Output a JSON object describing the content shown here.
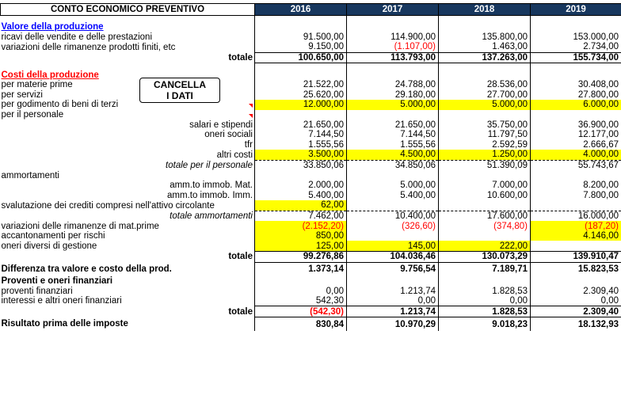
{
  "header": {
    "title": "CONTO ECONOMICO PREVENTIVO",
    "years": [
      "2016",
      "2017",
      "2018",
      "2019"
    ]
  },
  "button": {
    "label": "CANCELLA\nI DATI"
  },
  "rows": [
    {
      "type": "blank"
    },
    {
      "type": "section",
      "label": "Valore della produzione",
      "style": "blue"
    },
    {
      "label": "ricavi delle vendite e delle prestazioni",
      "values": [
        "91.500,00",
        "114.900,00",
        "135.800,00",
        "153.000,00"
      ]
    },
    {
      "label": "variazioni delle rimanenze prodotti finiti, etc",
      "values": [
        "9.150,00",
        "(1.107,00)",
        "1.463,00",
        "2.734,00"
      ],
      "neg": [
        false,
        true,
        false,
        false
      ]
    },
    {
      "type": "total",
      "label": "totale",
      "values": [
        "100.650,00",
        "113.793,00",
        "137.263,00",
        "155.734,00"
      ]
    },
    {
      "type": "blank"
    },
    {
      "type": "section",
      "label": "Costi della produzione",
      "style": "red"
    },
    {
      "label": "per materie prime",
      "values": [
        "21.522,00",
        "24.788,00",
        "28.536,00",
        "30.408,00"
      ]
    },
    {
      "label": "per servizi",
      "values": [
        "25.620,00",
        "29.180,00",
        "27.700,00",
        "27.800,00"
      ]
    },
    {
      "label": "per godimento di beni di terzi",
      "values": [
        "12.000,00",
        "5.000,00",
        "5.000,00",
        "6.000,00"
      ],
      "yellow": [
        true,
        true,
        true,
        true
      ]
    },
    {
      "label": "per il personale",
      "values": [
        "",
        "",
        "",
        ""
      ]
    },
    {
      "label": "salari e stipendi",
      "align": "right",
      "values": [
        "21.650,00",
        "21.650,00",
        "35.750,00",
        "36.900,00"
      ]
    },
    {
      "label": "oneri sociali",
      "align": "right",
      "values": [
        "7.144,50",
        "7.144,50",
        "11.797,50",
        "12.177,00"
      ]
    },
    {
      "label": "tfr",
      "align": "right",
      "values": [
        "1.555,56",
        "1.555,56",
        "2.592,59",
        "2.666,67"
      ]
    },
    {
      "label": "altri costi",
      "align": "right",
      "values": [
        "3.500,00",
        "4.500,00",
        "1.250,00",
        "4.000,00"
      ],
      "yellow": [
        true,
        true,
        true,
        true
      ]
    },
    {
      "type": "sub",
      "label": "totale per il personale",
      "values": [
        "33.850,06",
        "34.850,06",
        "51.390,09",
        "55.743,67"
      ]
    },
    {
      "label": "ammortamenti",
      "values": [
        "",
        "",
        "",
        ""
      ]
    },
    {
      "label": "amm.to immob. Mat.",
      "align": "right",
      "values": [
        "2.000,00",
        "5.000,00",
        "7.000,00",
        "8.200,00"
      ]
    },
    {
      "label": "amm.to immob. Imm.",
      "align": "right",
      "values": [
        "5.400,00",
        "5.400,00",
        "10.600,00",
        "7.800,00"
      ]
    },
    {
      "label": "svalutazione dei crediti compresi nell'attivo circolante",
      "indent": true,
      "values": [
        "62,00",
        "",
        "",
        ""
      ],
      "yellow": [
        true,
        false,
        false,
        false
      ]
    },
    {
      "type": "sub",
      "label": "totale ammortamenti",
      "values": [
        "7.462,00",
        "10.400,00",
        "17.600,00",
        "16.000,00"
      ]
    },
    {
      "label": "variazioni delle rimanenze di mat.prime",
      "values": [
        "(2.152,20)",
        "(326,60)",
        "(374,80)",
        "(187,20)"
      ],
      "neg": [
        true,
        true,
        true,
        true
      ],
      "yellow": [
        true,
        false,
        false,
        true
      ]
    },
    {
      "label": "accantonamenti per rischi",
      "values": [
        "850,00",
        "",
        "",
        "4.146,00"
      ],
      "yellow": [
        true,
        false,
        false,
        true
      ]
    },
    {
      "label": "oneri diversi di gestione",
      "values": [
        "125,00",
        "145,00",
        "222,00",
        ""
      ],
      "yellow": [
        true,
        true,
        true,
        false
      ]
    },
    {
      "type": "total",
      "label": "totale",
      "values": [
        "99.276,86",
        "104.036,46",
        "130.073,29",
        "139.910,47"
      ]
    },
    {
      "type": "bigbold",
      "label": "Differenza tra valore e costo della prod.",
      "values": [
        "1.373,14",
        "9.756,54",
        "7.189,71",
        "15.823,53"
      ]
    },
    {
      "type": "section",
      "label": "Proventi e oneri finanziari",
      "style": "plain"
    },
    {
      "label": "proventi finanziari",
      "values": [
        "0,00",
        "1.213,74",
        "1.828,53",
        "2.309,40"
      ]
    },
    {
      "label": "interessi e altri oneri finanziari",
      "values": [
        "542,30",
        "0,00",
        "0,00",
        "0,00"
      ]
    },
    {
      "type": "total",
      "label": "totale",
      "values": [
        "(542,30)",
        "1.213,74",
        "1.828,53",
        "2.309,40"
      ],
      "neg": [
        true,
        false,
        false,
        false
      ]
    },
    {
      "type": "bigbold",
      "label": "Risultato prima delle imposte",
      "values": [
        "830,84",
        "10.970,29",
        "9.018,23",
        "18.132,93"
      ]
    }
  ]
}
